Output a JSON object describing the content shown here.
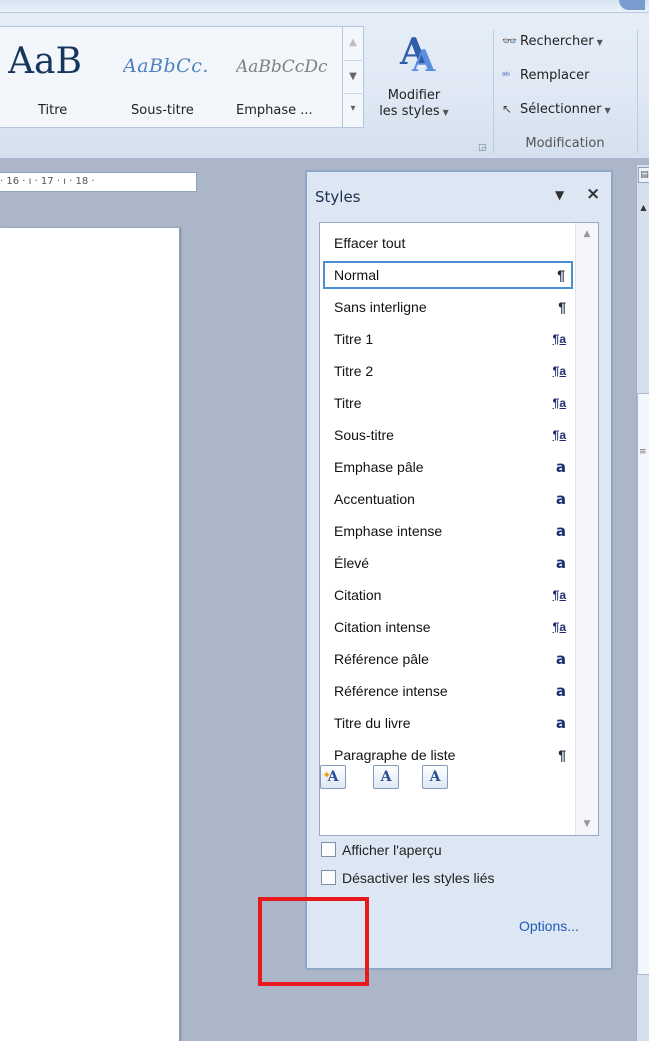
{
  "ribbon": {
    "gallery": [
      {
        "sample": "AaB",
        "label": "Titre"
      },
      {
        "sample": "AaBbCc.",
        "label": "Sous-titre"
      },
      {
        "sample": "AaBbCcDc",
        "label": "Emphase ..."
      }
    ],
    "modify_styles": {
      "line1": "Modifier",
      "line2": "les styles",
      "icon": "change-styles-icon"
    },
    "editing": {
      "find": "Rechercher",
      "replace": "Remplacer",
      "select": "Sélectionner",
      "group_label": "Modification"
    }
  },
  "ruler": {
    "text": "· 16 · ı · 17 · ı · 18 ·"
  },
  "styles_pane": {
    "title": "Styles",
    "items": [
      {
        "name": "Effacer tout",
        "type": ""
      },
      {
        "name": "Normal",
        "type": "para"
      },
      {
        "name": "Sans interligne",
        "type": "para"
      },
      {
        "name": "Titre 1",
        "type": "linked"
      },
      {
        "name": "Titre 2",
        "type": "linked"
      },
      {
        "name": "Titre",
        "type": "linked"
      },
      {
        "name": "Sous-titre",
        "type": "linked"
      },
      {
        "name": "Emphase pâle",
        "type": "char"
      },
      {
        "name": "Accentuation",
        "type": "char"
      },
      {
        "name": "Emphase intense",
        "type": "char"
      },
      {
        "name": "Élevé",
        "type": "char"
      },
      {
        "name": "Citation",
        "type": "linked"
      },
      {
        "name": "Citation intense",
        "type": "linked"
      },
      {
        "name": "Référence pâle",
        "type": "char"
      },
      {
        "name": "Référence intense",
        "type": "char"
      },
      {
        "name": "Titre du livre",
        "type": "char"
      },
      {
        "name": "Paragraphe de liste",
        "type": "para"
      }
    ],
    "selected_index": 1,
    "show_preview_label": "Afficher l'aperçu",
    "disable_linked_label": "Désactiver les styles liés",
    "options_label": "Options...",
    "type_glyphs": {
      "para": "¶",
      "linked": "¶a",
      "char": "a"
    }
  },
  "colors": {
    "highlight": "#e8191d",
    "selection": "#4a8fd4",
    "link": "#1c5bb8"
  }
}
